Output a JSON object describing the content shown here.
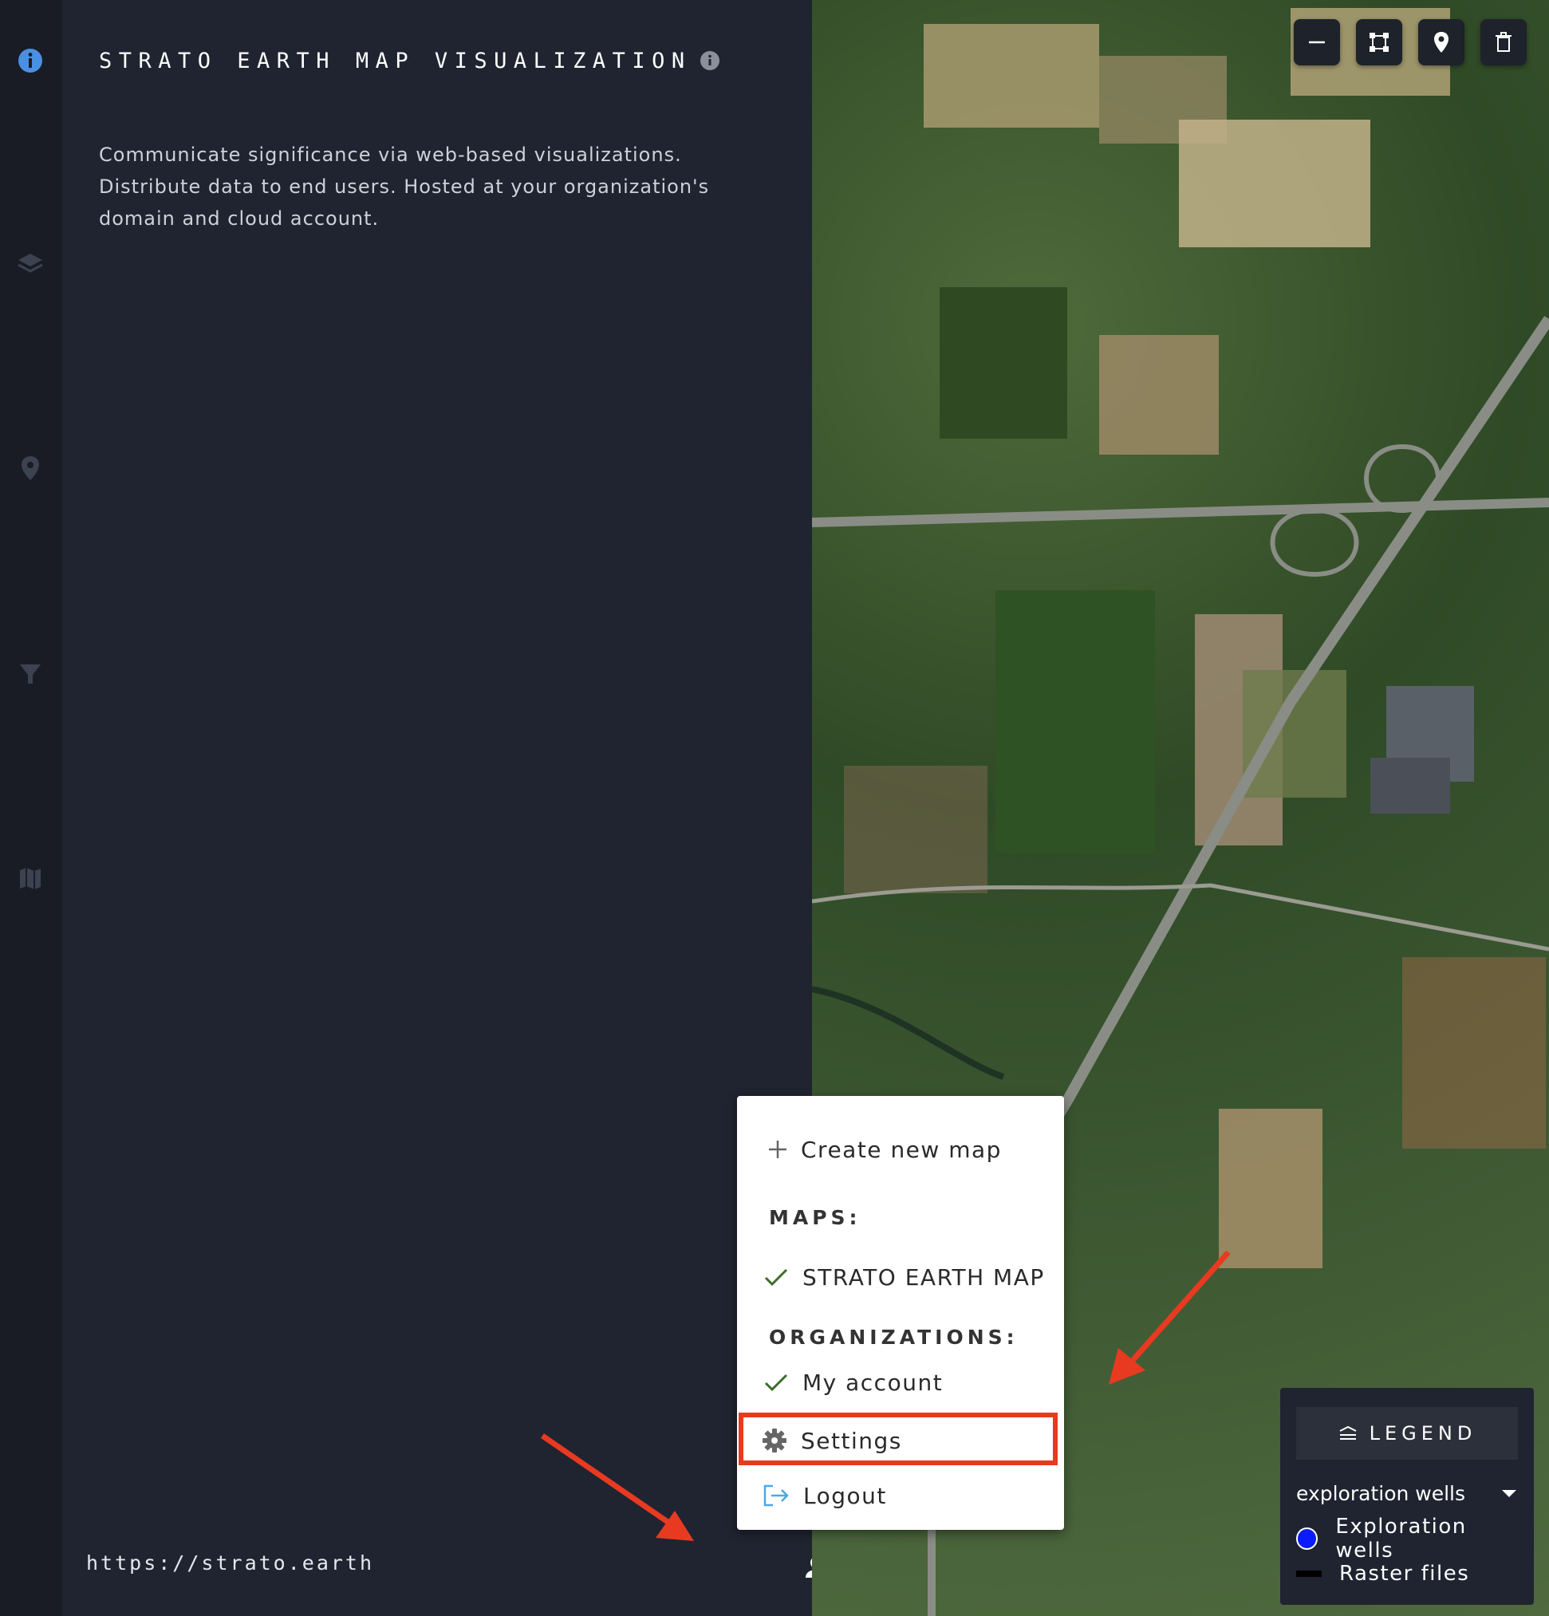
{
  "app": {
    "title": "STRATO EARTH MAP VISUALIZATION",
    "description": "Communicate significance via web-based visualizations. Distribute data to end users. Hosted at your organization's domain and cloud account.",
    "url": "https://strato.earth"
  },
  "rail": {
    "icons": [
      "info-icon",
      "layers-icon",
      "location-pin-icon",
      "filter-icon",
      "map-icon"
    ],
    "active_color": "#4a90e2",
    "inactive_color": "#3c4250"
  },
  "map_tools": [
    "minus-icon",
    "draw-polygon-icon",
    "place-marker-icon",
    "trash-icon"
  ],
  "menu": {
    "create_label": "Create new map",
    "maps_heading": "MAPS:",
    "map_item": "STRATO EARTH MAP",
    "orgs_heading": "ORGANIZATIONS:",
    "org_item": "My account",
    "settings_label": "Settings",
    "logout_label": "Logout"
  },
  "legend": {
    "title": "LEGEND",
    "selected_layer": "exploration wells",
    "items": [
      {
        "label": "Exploration wells",
        "color": "#0a1cff"
      },
      {
        "label": "Raster files",
        "color": "#000000"
      }
    ]
  },
  "colors": {
    "accent": "#4a90e2",
    "highlight": "#e83a21",
    "check": "#3c6e2a"
  }
}
